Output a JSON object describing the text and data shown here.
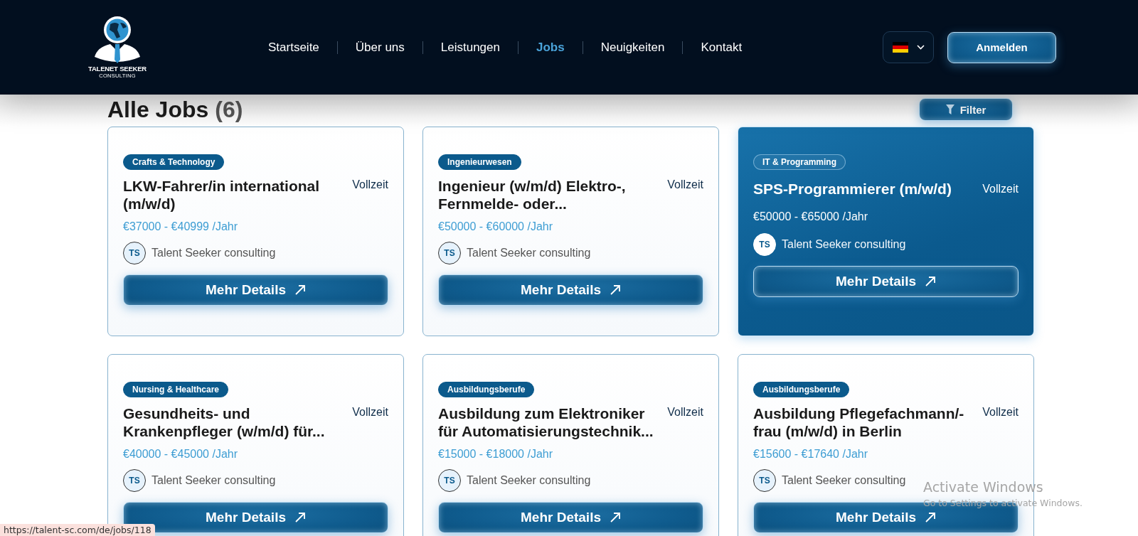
{
  "header": {
    "logo": {
      "title": "TALENET SEEKER",
      "subtitle": "CONSULTING"
    },
    "nav": [
      {
        "label": "Startseite",
        "selected": false
      },
      {
        "label": "Über uns",
        "selected": false
      },
      {
        "label": "Leistungen",
        "selected": false
      },
      {
        "label": "Jobs",
        "selected": true
      },
      {
        "label": "Neuigkeiten",
        "selected": false
      },
      {
        "label": "Kontakt",
        "selected": false
      }
    ],
    "login_button": "Anmelden"
  },
  "page": {
    "heading": "Alle Jobs",
    "count": "(6)",
    "filter_button": "Filter"
  },
  "jobs": [
    {
      "category": "Crafts & Technology",
      "title": "LKW-Fahrer/in international (m/w/d)",
      "type": "Vollzeit",
      "salary": "€37000 - €40999 /Jahr",
      "company_initials": "TS",
      "company": "Talent Seeker consulting",
      "button": "Mehr Details",
      "selected": false
    },
    {
      "category": "Ingenieurwesen",
      "title": "Ingenieur (w/m/d) Elektro-, Fernmelde- oder...",
      "type": "Vollzeit",
      "salary": "€50000 - €60000 /Jahr",
      "company_initials": "TS",
      "company": "Talent Seeker consulting",
      "button": "Mehr Details",
      "selected": false
    },
    {
      "category": "IT & Programming",
      "title": "SPS-Programmierer (m/w/d)",
      "type": "Vollzeit",
      "salary": "€50000 - €65000 /Jahr",
      "company_initials": "TS",
      "company": "Talent Seeker consulting",
      "button": "Mehr Details",
      "selected": true
    },
    {
      "category": "Nursing & Healthcare",
      "title": "Gesundheits- und Krankenpfleger (w/m/d) für...",
      "type": "Vollzeit",
      "salary": "€40000 - €45000 /Jahr",
      "company_initials": "TS",
      "company": "Talent Seeker consulting",
      "button": "Mehr Details",
      "selected": false
    },
    {
      "category": "Ausbildungsberufe",
      "title": "Ausbildung zum Elektroniker für Automatisierungstechnik...",
      "type": "Vollzeit",
      "salary": "€15000 - €18000 /Jahr",
      "company_initials": "TS",
      "company": "Talent Seeker consulting",
      "button": "Mehr Details",
      "selected": false
    },
    {
      "category": "Ausbildungsberufe",
      "title": "Ausbildung Pflegefachmann/-frau (m/w/d) in Berlin",
      "type": "Vollzeit",
      "salary": "€15600 - €17640 /Jahr",
      "company_initials": "TS",
      "company": "Talent Seeker consulting",
      "button": "Mehr Details",
      "selected": false
    }
  ],
  "status_url": "https://talent-sc.com/de/jobs/118",
  "os_overlay": {
    "title": "Activate Windows",
    "subtitle": "Go to Settings to activate Windows."
  }
}
